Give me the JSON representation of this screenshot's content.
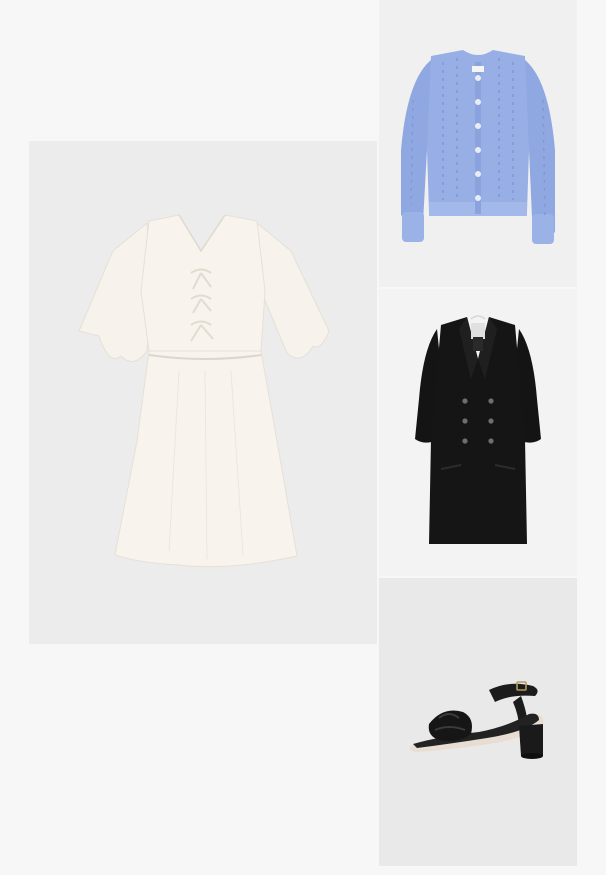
{
  "outfit": {
    "items": [
      {
        "id": "dress",
        "kind": "mini dress",
        "color": "#f6f1e8"
      },
      {
        "id": "cardigan",
        "kind": "knit cardigan",
        "color": "#93abe3"
      },
      {
        "id": "coat",
        "kind": "double-breasted coat",
        "color": "#151515"
      },
      {
        "id": "sandal",
        "kind": "block heel sandal",
        "color": "#1d1d1d"
      }
    ]
  }
}
